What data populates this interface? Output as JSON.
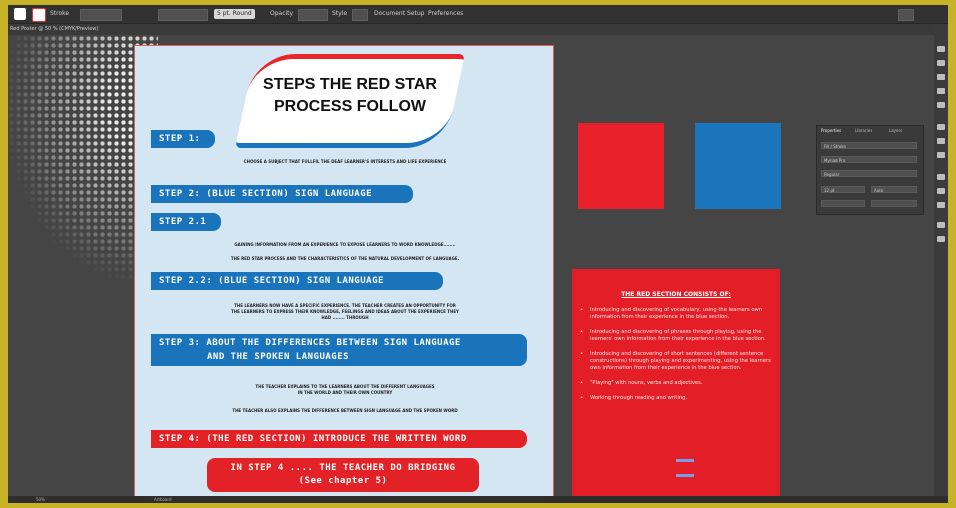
{
  "colors": {
    "frame": "#c8b327",
    "workspace": "#454545",
    "artboard_bg": "#d5e6f3",
    "brand_red": "#e32227",
    "brand_blue": "#1a74bc"
  },
  "toolbar": {
    "stroke_label": "Stroke",
    "uniform": "Uniform",
    "basic": "5 pt. Round",
    "opacity": "Opacity",
    "style": "Style",
    "doc_setup": "Document Setup",
    "preferences": "Preferences"
  },
  "document_tab": {
    "title": "Red Poster @ 50 % (CMYK/Preview)"
  },
  "poster": {
    "title_line1": "STEPS THE RED STAR",
    "title_line2": "PROCESS FOLLOW",
    "steps": [
      {
        "label": "STEP 1:"
      },
      {
        "label": "STEP 2:    (BLUE SECTION)   SIGN LANGUAGE"
      },
      {
        "label": "STEP 2.1"
      },
      {
        "label": "STEP 2.2:    (BLUE SECTION)    SIGN LANGUAGE"
      },
      {
        "label": "STEP 3:    ABOUT THE DIFFERENCES BETWEEN SIGN LANGUAGE"
      },
      {
        "label": "STEP 4:   (THE RED SECTION) INTRODUCE THE WRITTEN WORD"
      },
      {
        "label": "IN STEP 4 .... THE TEACHER DO BRIDGING"
      }
    ],
    "step3_line2": "AND THE SPOKEN LANGUAGES",
    "step4b_line2": "(See chapter 5)",
    "texts": {
      "t1": "CHOOSE A SUBJECT THAT FULLFIL THE DEAF LEARNER'S INTERESTS AND LIFE EXPERIENCE",
      "t2a": "GAINING INFORMATION FROM AN EXPERIENCE TO EXPOSE LEARNERS TO WORD KNOWLEDGE........",
      "t2b": "THE RED STAR PROCESS AND THE CHARACTERISTICS OF THE NATURAL DEVELOPMENT OF LANGUAGE.",
      "t3a": "THE LEARNERS NOW HAVE A SPECIFIC EXPERIENCE. THE TEACHER CREATES AN OPPORTUNITY FOR",
      "t3b": "THE LEARNERS TO EXPRESS THEIR KNOWLEDGE, FEELINGS AND IDEAS ABOUT THE EXPERIENCE THEY",
      "t3c": "HAD ........ THROUGH",
      "t4a": "THE TEACHER EXPLAINS TO THE LEARNERS ABOUT THE DIFFERENT LANGUAGES",
      "t4b": "IN THE WORLD AND THEIR OWN COUNTRY",
      "t5": "THE TEACHER ALSO EXPLAINS THE DIFFERENCE BETWEEN SIGN LANGUAGE AND THE SPOKEN WORD"
    }
  },
  "swatches": [
    {
      "name": "red",
      "color": "#e8202a"
    },
    {
      "name": "blue",
      "color": "#1a75bd"
    }
  ],
  "panel": {
    "tab1": "Properties",
    "tab2": "Libraries",
    "tab3": "Layers",
    "row1": "Fill / Stroke",
    "row2": "Myriad Pro",
    "row3": "Regular",
    "row4": "12 pt",
    "row5": "Auto"
  },
  "red_panel": {
    "title": "THE RED SECTION CONSISTS OF:",
    "items": [
      "Introducing and discovering of vocabulary, using the learners own information from their experience in the blue section.",
      "Introducing and discovering of phrases through playing, using the learners' own information from their experience in the blue section.",
      "Introducing and discovering of short sentences (different sentence constructions) through playing and experimenting, using the learners own information from their experience in the blue section.",
      "\"Playing\" with nouns, verbs and adjectives.",
      "Working through reading and writing."
    ]
  },
  "statusbar": {
    "zoom": "50%",
    "artboard": "Artboard"
  }
}
